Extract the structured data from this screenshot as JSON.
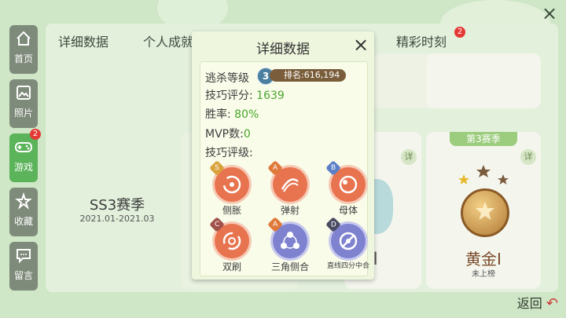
{
  "panel": {
    "tabs": [
      "详细数据",
      "个人成就",
      "精彩时刻"
    ],
    "tab_badge": "2"
  },
  "sidebar": {
    "items": [
      {
        "label": "首页",
        "icon": "home-icon"
      },
      {
        "label": "照片",
        "icon": "photo-icon"
      },
      {
        "label": "游戏",
        "icon": "gamepad-icon",
        "badge": "2",
        "active": true
      },
      {
        "label": "收藏",
        "icon": "star-icon"
      },
      {
        "label": "留言",
        "icon": "message-icon"
      }
    ]
  },
  "season_card": {
    "name": "SS3赛季",
    "date_range": "2021.01-2021.03"
  },
  "medal_card": {
    "header": "第3赛季",
    "detail_btn": "详",
    "rank": "黄金Ⅰ",
    "status": "未上榜"
  },
  "mid_card": {
    "detail_btn": "详",
    "rank_partial": "Ⅱ"
  },
  "return_label": "返回",
  "modal": {
    "title": "详细数据",
    "escape_label": "逃杀等级",
    "escape_level": "3",
    "rank_text": "排名:616,194",
    "skill_score_label": "技巧评分:",
    "skill_score": "1639",
    "win_rate_label": "胜率:",
    "win_rate": "80%",
    "mvp_label": "MVP数:",
    "mvp": "0",
    "skill_grade_label": "技巧评级:",
    "skills": [
      {
        "name": "侧胀",
        "grade": "S"
      },
      {
        "name": "弹射",
        "grade": "A"
      },
      {
        "name": "母体",
        "grade": "B"
      },
      {
        "name": "双刷",
        "grade": "C"
      },
      {
        "name": "三角侧合",
        "grade": "A"
      },
      {
        "name": "直线四分中合",
        "grade": "D"
      }
    ]
  },
  "colors": {
    "accent_green": "#5bb35a",
    "value_green": "#47a52b",
    "orange_skill": "#e8734f",
    "purple_skill": "#7f82cf"
  }
}
